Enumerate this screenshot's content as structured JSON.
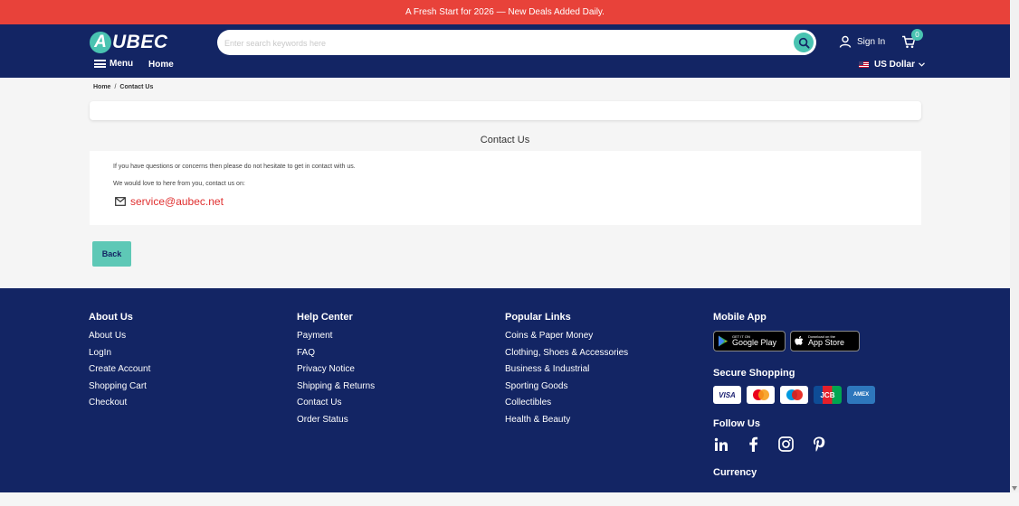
{
  "promo": {
    "text": "A Fresh Start for 2026 — New Deals Added Daily."
  },
  "header": {
    "logo_letter": "A",
    "logo_text": "UBEC",
    "search_placeholder": "Enter search keywords here",
    "sign_in": "Sign In",
    "cart_count": "0",
    "menu_label": "Menu",
    "home_label": "Home",
    "currency_label": "US Dollar"
  },
  "breadcrumb": {
    "home": "Home",
    "separator": "/",
    "current": "Contact Us"
  },
  "page": {
    "title": "Contact Us",
    "intro": "If you have questions or concerns then please do not hesitate to get in contact with us.",
    "love": "We would love to here from you, contact us on:",
    "email": "service@aubec.net",
    "back_label": "Back"
  },
  "footer": {
    "about": {
      "heading": "About Us",
      "links": [
        "About Us",
        "LogIn",
        "Create Account",
        "Shopping Cart",
        "Checkout"
      ]
    },
    "help": {
      "heading": "Help Center",
      "links": [
        "Payment",
        "FAQ",
        "Privacy Notice",
        "Shipping & Returns",
        "Contact Us",
        "Order Status"
      ]
    },
    "popular": {
      "heading": "Popular Links",
      "links": [
        "Coins & Paper Money",
        "Clothing, Shoes & Accessories",
        "Business & Industrial",
        "Sporting Goods",
        "Collectibles",
        "Health & Beauty"
      ]
    },
    "mobile": {
      "heading": "Mobile App",
      "google_small": "GET IT ON",
      "google_big": "Google Play",
      "apple_small": "Download on the",
      "apple_big": "App Store"
    },
    "secure": {
      "heading": "Secure Shopping",
      "visa": "VISA",
      "jcb": "JCB",
      "amex": "AMEX"
    },
    "follow": {
      "heading": "Follow Us"
    },
    "currency": {
      "heading": "Currency"
    }
  },
  "colors": {
    "promo": "#e8423a",
    "header": "#132564",
    "accent": "#49c3b1",
    "email": "#e03030"
  },
  "icons": [
    "search-icon",
    "user-icon",
    "cart-icon",
    "menu-icon",
    "chevron-down-icon",
    "mail-icon",
    "google-play-icon",
    "apple-icon",
    "linkedin-icon",
    "facebook-icon",
    "instagram-icon",
    "pinterest-icon"
  ]
}
